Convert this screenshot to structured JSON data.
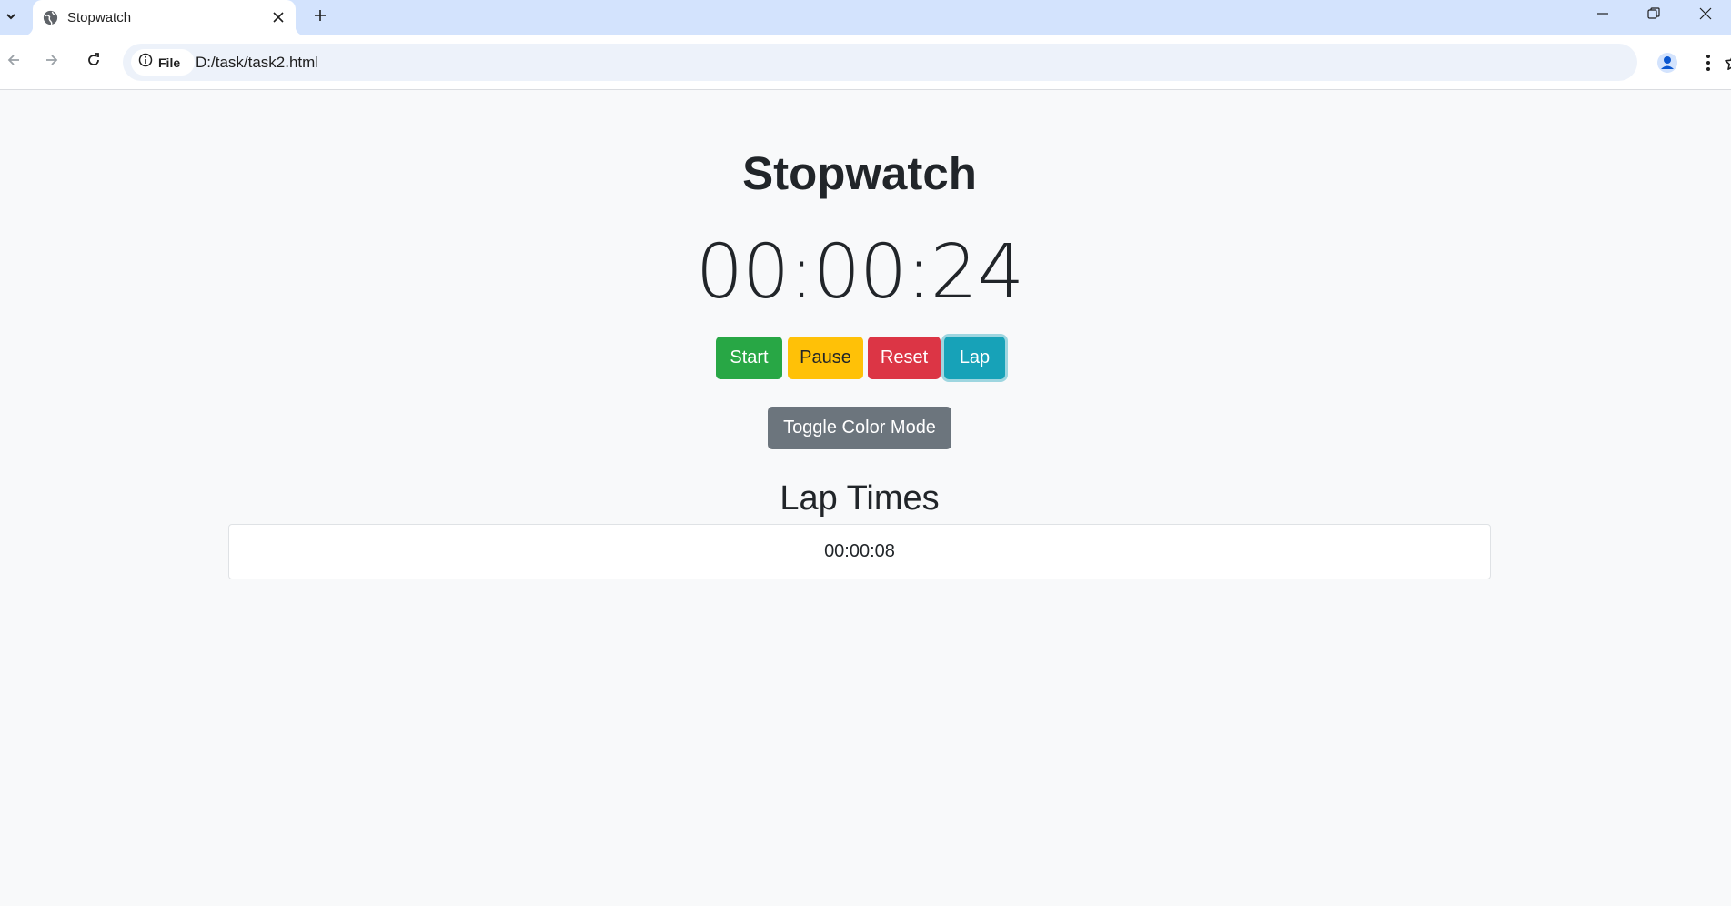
{
  "browser": {
    "tab": {
      "title": "Stopwatch"
    },
    "address": {
      "chip_label": "File",
      "url": "D:/task/task2.html"
    }
  },
  "app": {
    "title": "Stopwatch",
    "time": "00:00:24",
    "buttons": {
      "start": "Start",
      "pause": "Pause",
      "reset": "Reset",
      "lap": "Lap",
      "toggle": "Toggle Color Mode"
    },
    "lap_heading": "Lap Times",
    "laps": [
      "00:00:08"
    ]
  },
  "colors": {
    "start": "#28a745",
    "pause": "#ffc107",
    "reset": "#dc3545",
    "lap": "#17a2b8",
    "toggle": "#6c757d",
    "background": "#f8f9fa"
  },
  "icons": [
    "tab-search-icon",
    "globe-icon",
    "close-icon",
    "plus-icon",
    "minimize-icon",
    "restore-icon",
    "back-icon",
    "forward-icon",
    "reload-icon",
    "info-icon",
    "star-icon",
    "profile-icon",
    "more-menu-icon"
  ]
}
